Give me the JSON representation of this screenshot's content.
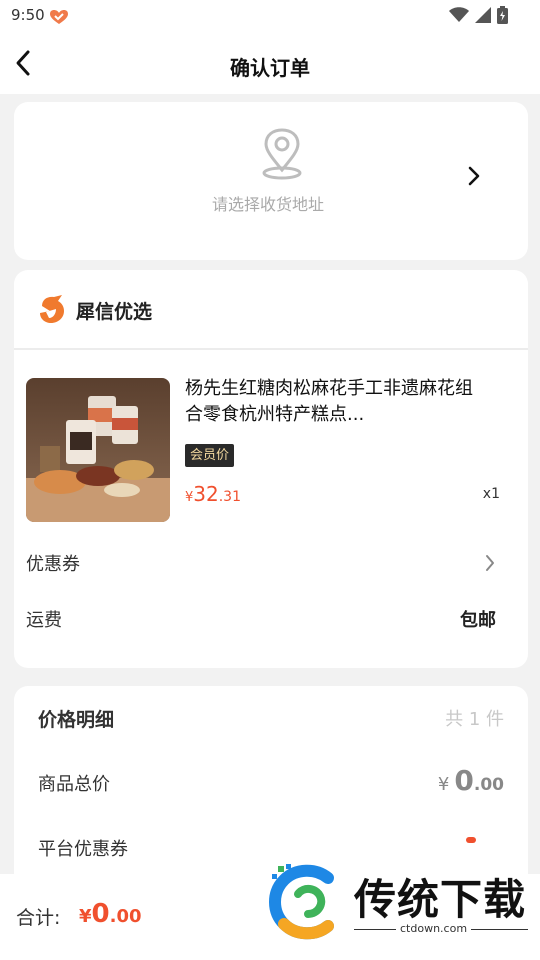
{
  "status_bar": {
    "time": "9:50"
  },
  "header": {
    "title": "确认订单"
  },
  "address": {
    "hint": "请选择收货地址"
  },
  "shop": {
    "name": "犀信优选"
  },
  "product": {
    "title": "杨先生红糖肉松麻花手工非遗麻花组合零食杭州特产糕点...",
    "member_tag": "会员价",
    "price_currency": "¥",
    "price_int": "32",
    "price_dec": ".31",
    "quantity": "x1"
  },
  "order_rows": {
    "coupon_label": "优惠券",
    "shipping_label": "运费",
    "shipping_value": "包邮"
  },
  "price_detail": {
    "title": "价格明细",
    "count": "共 1 件",
    "goods_total_label": "商品总价",
    "goods_total_currency": "¥",
    "goods_total_int": "0",
    "goods_total_dec": ".00",
    "platform_coupon_label": "平台优惠券"
  },
  "footer": {
    "total_label": "合计:",
    "total_currency": "¥",
    "total_int": "0",
    "total_dec": ".00"
  },
  "watermark": {
    "brand": "传统下载",
    "url": "ctdown.com"
  },
  "colors": {
    "accent": "#f0502e",
    "member_tag_bg": "#2a2a2a",
    "member_tag_text": "#f1d79e",
    "background": "#f2f2f2"
  }
}
